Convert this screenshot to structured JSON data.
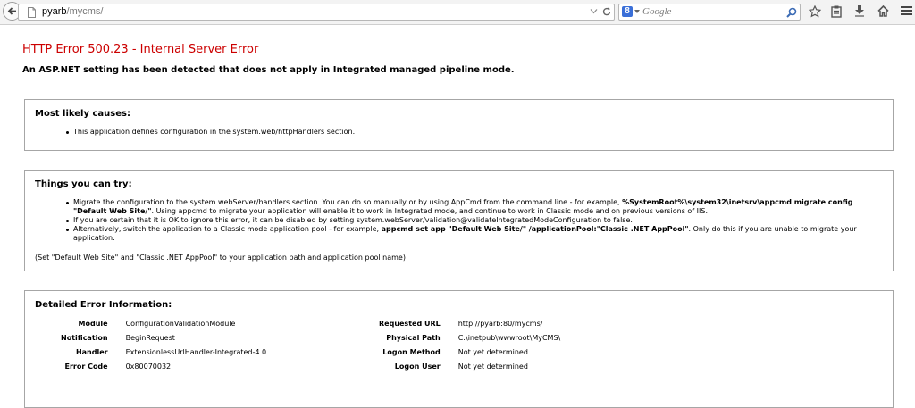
{
  "browser": {
    "url_host": "pyarb",
    "url_path": "/mycms/",
    "search_placeholder": "Google",
    "search_engine_letter": "8",
    "icons": [
      "back-arrow-icon",
      "page-icon",
      "dropdown-arrow-icon",
      "reload-icon",
      "google-icon",
      "search-icon",
      "star-icon",
      "clipboard-icon",
      "download-icon",
      "home-icon",
      "menu-icon"
    ]
  },
  "page": {
    "title": "HTTP Error 500.23 - Internal Server Error",
    "subtitle": "An ASP.NET setting has been detected that does not apply in Integrated managed pipeline mode."
  },
  "causes": {
    "heading": "Most likely causes:",
    "items": [
      "This application defines configuration in the system.web/httpHandlers section."
    ]
  },
  "try": {
    "heading": "Things you can try:",
    "item1": {
      "text1": "Migrate the configuration to the system.webServer/handlers section. You can do so manually or by using AppCmd from the command line - for example, ",
      "bold1": "%SystemRoot%\\system32\\inetsrv\\appcmd migrate config \"Default Web Site/\"",
      "text2": ". Using appcmd to migrate your application will enable it to work in Integrated mode, and continue to work in Classic mode and on previous versions of IIS."
    },
    "item2": "If you are certain that it is OK to ignore this error, it can be disabled by setting system.webServer/validation@validateIntegratedModeConfiguration to false.",
    "item3": {
      "text1": "Alternatively, switch the application to a Classic mode application pool - for example, ",
      "bold1": "appcmd set app \"Default Web Site/\" /applicationPool:\"Classic .NET AppPool\"",
      "text2": ". Only do this if you are unable to migrate your application."
    },
    "note": "(Set \"Default Web Site\" and \"Classic .NET AppPool\" to your application path and application pool name)"
  },
  "details": {
    "heading": "Detailed Error Information:",
    "left": [
      {
        "label": "Module",
        "value": "ConfigurationValidationModule"
      },
      {
        "label": "Notification",
        "value": "BeginRequest"
      },
      {
        "label": "Handler",
        "value": "ExtensionlessUrlHandler-Integrated-4.0"
      },
      {
        "label": "Error Code",
        "value": "0x80070032"
      }
    ],
    "right": [
      {
        "label": "Requested URL",
        "value": "http://pyarb:80/mycms/"
      },
      {
        "label": "Physical Path",
        "value": "C:\\inetpub\\wwwroot\\MyCMS\\"
      },
      {
        "label": "Logon Method",
        "value": "Not yet determined"
      },
      {
        "label": "Logon User",
        "value": "Not yet determined"
      }
    ]
  }
}
